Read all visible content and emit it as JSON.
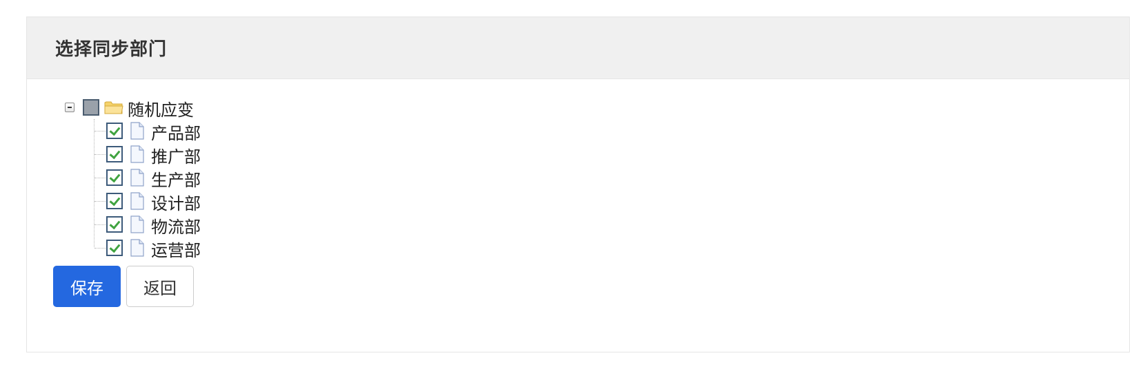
{
  "header": {
    "title": "选择同步部门"
  },
  "tree": {
    "root": {
      "label": "随机应变",
      "state": "partial",
      "icon": "folder-open-icon"
    },
    "children": [
      {
        "label": "产品部",
        "checked": true,
        "icon": "file-icon"
      },
      {
        "label": "推广部",
        "checked": true,
        "icon": "file-icon"
      },
      {
        "label": "生产部",
        "checked": true,
        "icon": "file-icon"
      },
      {
        "label": "设计部",
        "checked": true,
        "icon": "file-icon"
      },
      {
        "label": "物流部",
        "checked": true,
        "icon": "file-icon"
      },
      {
        "label": "运营部",
        "checked": true,
        "icon": "file-icon"
      }
    ]
  },
  "actions": {
    "save_label": "保存",
    "back_label": "返回"
  },
  "colors": {
    "primary": "#2468e0",
    "header_bg": "#f0f0f0",
    "check_green": "#3fa33f",
    "folder_yellow": "#f5d26a"
  }
}
